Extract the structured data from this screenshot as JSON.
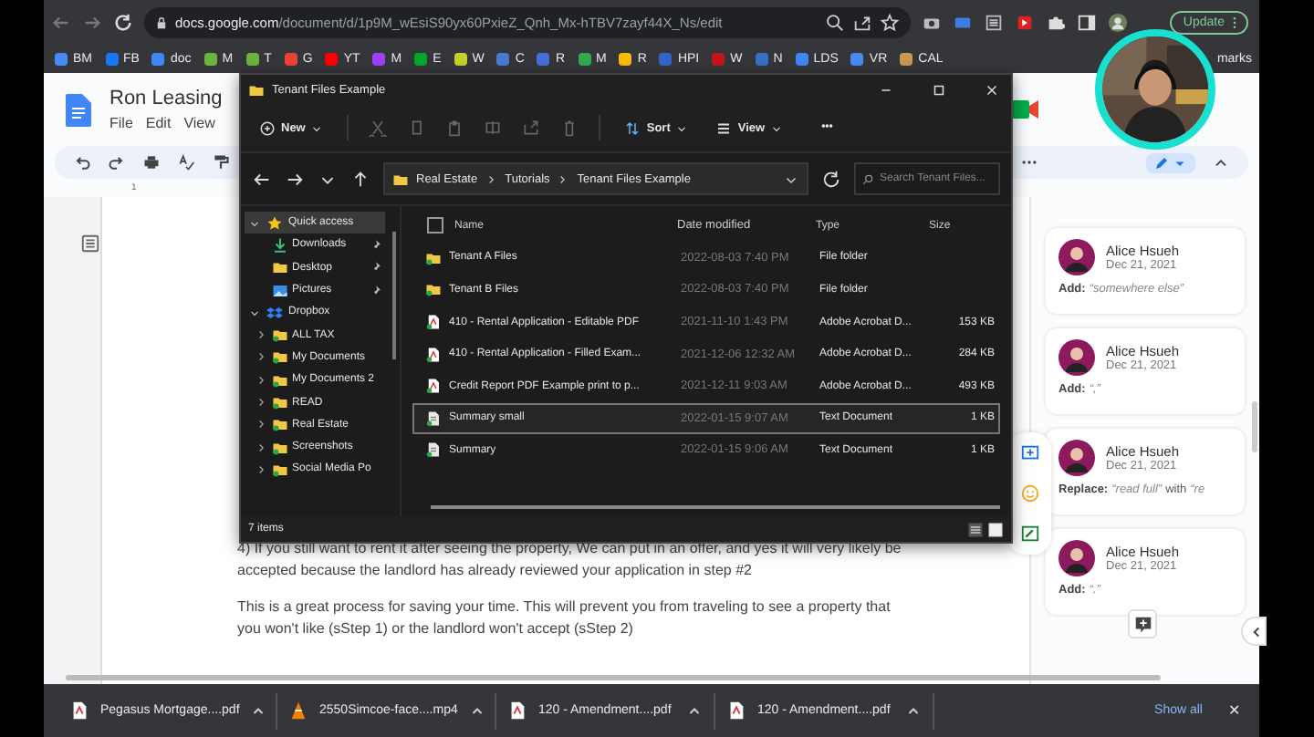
{
  "browser": {
    "address_host": "docs.google.com",
    "address_path": "/document/d/1p9M_wEsiS90yx60PxieZ_Qnh_Mx-hTBV7zayf44X_Ns/edit",
    "update_button": "Update",
    "bookmarks": [
      {
        "label": "BM",
        "color": "#4a8af4"
      },
      {
        "label": "FB",
        "color": "#1877f2"
      },
      {
        "label": "doc",
        "color": "#4285f4"
      },
      {
        "label": "M",
        "color": "#6db33f"
      },
      {
        "label": "T",
        "color": "#6db33f"
      },
      {
        "label": "G",
        "color": "#ea4335"
      },
      {
        "label": "YT",
        "color": "#ff0000"
      },
      {
        "label": "M",
        "color": "#a040ff"
      },
      {
        "label": "E",
        "color": "#00a82d"
      },
      {
        "label": "W",
        "color": "#c5d12a"
      },
      {
        "label": "C",
        "color": "#4a7bd0"
      },
      {
        "label": "R",
        "color": "#4a6dd8"
      },
      {
        "label": "M",
        "color": "#34a853"
      },
      {
        "label": "R",
        "color": "#fbbc04"
      },
      {
        "label": "HPI",
        "color": "#3366cc"
      },
      {
        "label": "W",
        "color": "#c4161c"
      },
      {
        "label": "N",
        "color": "#3a70c8"
      },
      {
        "label": "LDS",
        "color": "#4285f4"
      },
      {
        "label": "VR",
        "color": "#4a8af4"
      },
      {
        "label": "CAL",
        "color": "#c89b52"
      }
    ],
    "other_bookmarks": "marks"
  },
  "docs": {
    "title": "Ron Leasing",
    "menu": [
      "File",
      "Edit",
      "View"
    ],
    "ruler_mark": "1",
    "paragraphs": [
      "4) If you still want to rent it after seeing the property, We can put in an offer, and yes it will very likely be accepted because the landlord has already reviewed your application in step #2",
      "This is a great process for saving your time. This will prevent you from traveling to see a property that you won't like (sStep 1) or the landlord won't accept (sStep 2)"
    ],
    "comments": [
      {
        "author": "Alice Hsueh",
        "date": "Dec 21, 2021",
        "action": "Add:",
        "quote": "“somewhere else”"
      },
      {
        "author": "Alice Hsueh",
        "date": "Dec 21, 2021",
        "action": "Add:",
        "quote": "“,”"
      },
      {
        "author": "Alice Hsueh",
        "date": "Dec 21, 2021",
        "action": "Replace:",
        "quote": "“read full”",
        "connector": "with",
        "quote2": "“re"
      },
      {
        "author": "Alice Hsueh",
        "date": "Dec 21, 2021",
        "action": "Add:",
        "quote": "“.”"
      }
    ]
  },
  "explorer": {
    "title": "Tenant Files Example",
    "new_button": "New",
    "tools": [
      {
        "kind": "cut",
        "disabled": true
      },
      {
        "kind": "copy",
        "disabled": true
      },
      {
        "kind": "paste",
        "disabled": true
      },
      {
        "kind": "rename",
        "disabled": true
      },
      {
        "kind": "share",
        "disabled": true
      },
      {
        "kind": "delete",
        "disabled": true
      }
    ],
    "sort_button": "Sort",
    "view_button": "View",
    "more_button": "•••",
    "path": [
      "Real Estate",
      "Tutorials",
      "Tenant Files Example"
    ],
    "search": {
      "placeholder": "Search Tenant Files..."
    },
    "nav": [
      {
        "label": "Quick access",
        "kind": "star",
        "expanded": true,
        "selected": true,
        "children": [
          {
            "label": "Downloads",
            "kind": "downloads",
            "pinned": true
          },
          {
            "label": "Desktop",
            "kind": "desktop",
            "pinned": true
          },
          {
            "label": "Pictures",
            "kind": "pictures",
            "pinned": true
          }
        ]
      },
      {
        "label": "Dropbox",
        "kind": "dropbox",
        "expanded": true,
        "selected": false,
        "children": [
          {
            "label": "ALL TAX",
            "kind": "folder",
            "expanded": false
          },
          {
            "label": "My Documents",
            "kind": "folder",
            "expanded": false
          },
          {
            "label": "My Documents 2",
            "kind": "folder",
            "expanded": false
          },
          {
            "label": "READ",
            "kind": "folder",
            "expanded": false
          },
          {
            "label": "Real Estate",
            "kind": "folder",
            "expanded": false
          },
          {
            "label": "Screenshots",
            "kind": "folder",
            "expanded": false
          },
          {
            "label": "Social Media Po",
            "kind": "folder",
            "expanded": false
          }
        ]
      }
    ],
    "select_all_checked": false,
    "columns": [
      "Name",
      "Date modified",
      "Type",
      "Size"
    ],
    "rows": [
      {
        "kind": "folder",
        "name": "Tenant A Files",
        "date": "2022-08-03 7:40 PM",
        "type": "File folder",
        "selected": false
      },
      {
        "kind": "folder",
        "name": "Tenant B Files",
        "date": "2022-08-03 7:40 PM",
        "type": "File folder",
        "selected": false
      },
      {
        "kind": "pdf",
        "name": "410 - Rental Application - Editable PDF",
        "date": "2021-11-10 1:43 PM",
        "type": "Adobe Acrobat D...",
        "size": "153 KB",
        "selected": false
      },
      {
        "kind": "pdf",
        "name": "410 - Rental Application - Filled Exam...",
        "date": "2021-12-06 12:32 AM",
        "type": "Adobe Acrobat D...",
        "size": "284 KB",
        "selected": false
      },
      {
        "kind": "pdf",
        "name": "Credit Report PDF Example print to p...",
        "date": "2021-12-11 9:03 AM",
        "type": "Adobe Acrobat D...",
        "size": "493 KB",
        "selected": false
      },
      {
        "kind": "text",
        "name": "Summary small",
        "date": "2022-01-15 9:07 AM",
        "type": "Text Document",
        "size": "1 KB",
        "selected": true
      },
      {
        "kind": "text",
        "name": "Summary",
        "date": "2022-01-15 9:06 AM",
        "type": "Text Document",
        "size": "1 KB",
        "selected": false
      }
    ],
    "status": "7 items"
  },
  "downloads": {
    "items": [
      {
        "kind": "pdf",
        "name": "Pegasus Mortgage....pdf"
      },
      {
        "kind": "video",
        "name": "2550Simcoe-face....mp4"
      },
      {
        "kind": "pdf",
        "name": "120 - Amendment....pdf"
      },
      {
        "kind": "pdf",
        "name": "120 - Amendment....pdf"
      }
    ],
    "show_all": "Show all",
    "close": "✕"
  }
}
